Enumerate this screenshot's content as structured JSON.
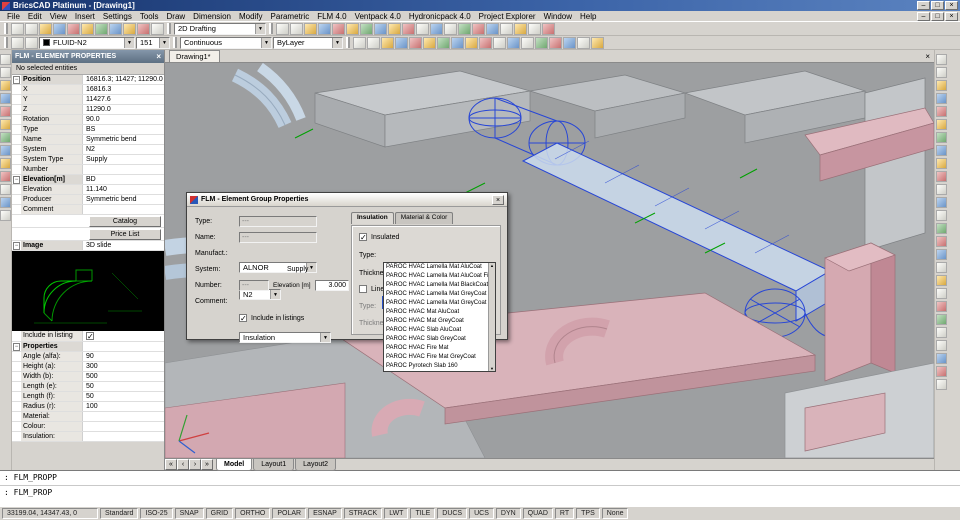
{
  "window": {
    "title": "BricsCAD Platinum - [Drawing1]"
  },
  "menubar": {
    "items": [
      "File",
      "Edit",
      "View",
      "Insert",
      "Settings",
      "Tools",
      "Draw",
      "Dimension",
      "Modify",
      "Parametric",
      "FLM 4.0",
      "Ventpack 4.0",
      "Hydronicpack 4.0",
      "Project Explorer",
      "Window",
      "Help"
    ]
  },
  "toolbar1": {
    "icons_left": [
      "new-icon",
      "open-icon",
      "save-icon",
      "print-icon",
      "plot-preview-icon",
      "cut-icon",
      "copy-icon",
      "paste-icon",
      "match-properties-icon",
      "undo-icon",
      "redo-icon"
    ],
    "workspace": "2D Drafting",
    "icons_right": [
      "pan-icon",
      "zoom-icon",
      "zoom-window-icon",
      "zoom-extents-icon",
      "named-view-icon",
      "layers-icon",
      "drawing-explorer-icon",
      "distance-icon",
      "render-icon",
      "settings-icon",
      "tool-icon",
      "tool-icon",
      "tool-icon",
      "tool-icon",
      "tool-icon",
      "tool-icon",
      "tool-icon",
      "tool-icon",
      "tool-icon",
      "tool-icon"
    ]
  },
  "toolbar2": {
    "icons_left": [
      "layer-settings-icon",
      "layer-previous-icon"
    ],
    "layer": "FLUID-N2",
    "field2": "151",
    "linetype": "Continuous",
    "lineweight": "ByLayer",
    "icons_right": [
      "tool-icon",
      "tool-icon",
      "tool-icon",
      "tool-icon",
      "tool-icon",
      "tool-icon",
      "tool-icon",
      "tool-icon",
      "tool-icon",
      "tool-icon",
      "tool-icon",
      "tool-icon",
      "tool-icon",
      "tool-icon",
      "tool-icon",
      "tool-icon",
      "tool-icon",
      "tool-icon"
    ]
  },
  "left_toolbar": {
    "icons": [
      "select-icon",
      "line-icon",
      "polyline-icon",
      "circle-icon",
      "arc-icon",
      "rectangle-icon",
      "hatch-icon",
      "text-icon",
      "dimension-icon",
      "move-icon",
      "rotate-icon",
      "mirror-icon",
      "erase-icon"
    ]
  },
  "right_toolbar": {
    "icons": [
      "duct-icon",
      "duct-bend-icon",
      "duct-tee-icon",
      "duct-transition-icon",
      "duct-cap-icon",
      "round-duct-icon",
      "flex-duct-icon",
      "diffuser-icon",
      "damper-icon",
      "fan-icon",
      "filter-icon",
      "silencer-icon",
      "grille-icon",
      "tool-icon",
      "tool-icon",
      "tool-icon",
      "tool-icon",
      "tool-icon",
      "tool-icon",
      "tool-icon",
      "tool-icon",
      "tool-icon",
      "tool-icon",
      "tool-icon",
      "tool-icon",
      "tool-icon"
    ]
  },
  "doc_tab": {
    "label": "Drawing1*"
  },
  "panel": {
    "title": "FLM - ELEMENT PROPERTIES",
    "status": "No selected entities",
    "rows_top": [
      {
        "label": "Position",
        "value": "16816.3; 11427; 11290.0",
        "group": true
      },
      {
        "label": "X",
        "value": "16816.3"
      },
      {
        "label": "Y",
        "value": "11427.6"
      },
      {
        "label": "Z",
        "value": "11290.0"
      },
      {
        "label": "Rotation",
        "value": "90.0"
      },
      {
        "label": "Type",
        "value": "BS"
      },
      {
        "label": "Name",
        "value": "Symmetric bend"
      },
      {
        "label": "System",
        "value": "N2"
      },
      {
        "label": "System Type",
        "value": "Supply"
      },
      {
        "label": "Number",
        "value": ""
      },
      {
        "label": "Elevation[m]",
        "value": "BD",
        "group": true
      },
      {
        "label": "Elevation",
        "value": "11.140"
      },
      {
        "label": "Producer",
        "value": "Symmetric bend"
      },
      {
        "label": "Comment",
        "value": ""
      }
    ],
    "catalog_button": "Catalog",
    "price_button": "Price List",
    "image_group": "Image",
    "image_value": "3D slide",
    "include_label": "Include in listing",
    "rows_bottom": [
      {
        "label": "Properties",
        "value": "",
        "group": true
      },
      {
        "label": "Angle (alfa):",
        "value": "90"
      },
      {
        "label": "Height (a):",
        "value": "300"
      },
      {
        "label": "Width (b):",
        "value": "500"
      },
      {
        "label": "Length (e):",
        "value": "50"
      },
      {
        "label": "Length (f):",
        "value": "50"
      },
      {
        "label": "Radius (r):",
        "value": "100"
      },
      {
        "label": "Material:",
        "value": ""
      },
      {
        "label": "Colour:",
        "value": ""
      },
      {
        "label": "Insulation:",
        "value": ""
      }
    ]
  },
  "dialog": {
    "title": "FLM - Element Group Properties",
    "labels": {
      "type": "Type:",
      "name": "Name:",
      "manufact": "Manufact.:",
      "system": "System:",
      "supply": "Supply",
      "number": "Number:",
      "elevation": "Elevation [m]",
      "comment": "Comment:",
      "include": "Include in listings"
    },
    "values": {
      "type": "---",
      "name": "---",
      "manufact": "ALNOR",
      "system": "N2",
      "number": "---",
      "elevation": "3.000",
      "comment": "Insulation"
    },
    "tabs": [
      {
        "label": "Insulation",
        "active": true
      },
      {
        "label": "Material & Color",
        "active": false
      }
    ],
    "insulation": {
      "insulated": "Insulated",
      "type_label": "Type:",
      "thickness_label": "Thickness:",
      "lined": "Lined",
      "type2_label": "Type:",
      "thickness2_label": "Thickness:"
    },
    "type_options": [
      "PAROC HVAC Lamella Mat AluCoat",
      "PAROC HVAC Lamella Mat AluCoat Fix",
      "PAROC HVAC Lamella Mat BlackCoat",
      "PAROC HVAC Lamella Mat GreyCoat",
      "PAROC HVAC Lamella Mat GreyCoat Fix",
      "PAROC HVAC Mat AluCoat",
      "PAROC HVAC Mat GreyCoat",
      "PAROC HVAC Slab AluCoat",
      "PAROC HVAC Slab GreyCoat",
      "PAROC HVAC Fire Mat",
      "PAROC HVAC Fire Mat GreyCoat",
      "PAROC Pyrotech Slab 160"
    ]
  },
  "layout_tabs": {
    "tabs": [
      {
        "label": "Model",
        "active": true
      },
      {
        "label": "Layout1",
        "active": false
      },
      {
        "label": "Layout2",
        "active": false
      }
    ]
  },
  "command": {
    "history": ": FLM_PROPP",
    "input": ": FLM_PROP"
  },
  "statusbar": {
    "coords": "33199.04, 14347.43, 0",
    "style": "Standard",
    "dimstyle": "ISO-25",
    "toggles": [
      "SNAP",
      "GRID",
      "ORTHO",
      "POLAR",
      "ESNAP",
      "STRACK",
      "LWT",
      "TILE",
      "DUCS",
      "UCS",
      "DYN",
      "QUAD",
      "RT",
      "TPS",
      "None"
    ]
  },
  "colors": {
    "selection_blue": "#2746d6",
    "duct_pink": "#d9b3ba",
    "duct_blue": "#c3d3e3",
    "duct_gray": "#b6b9bc",
    "viewport_bg": "#9d9fa1",
    "accent_green": "#00a000"
  }
}
